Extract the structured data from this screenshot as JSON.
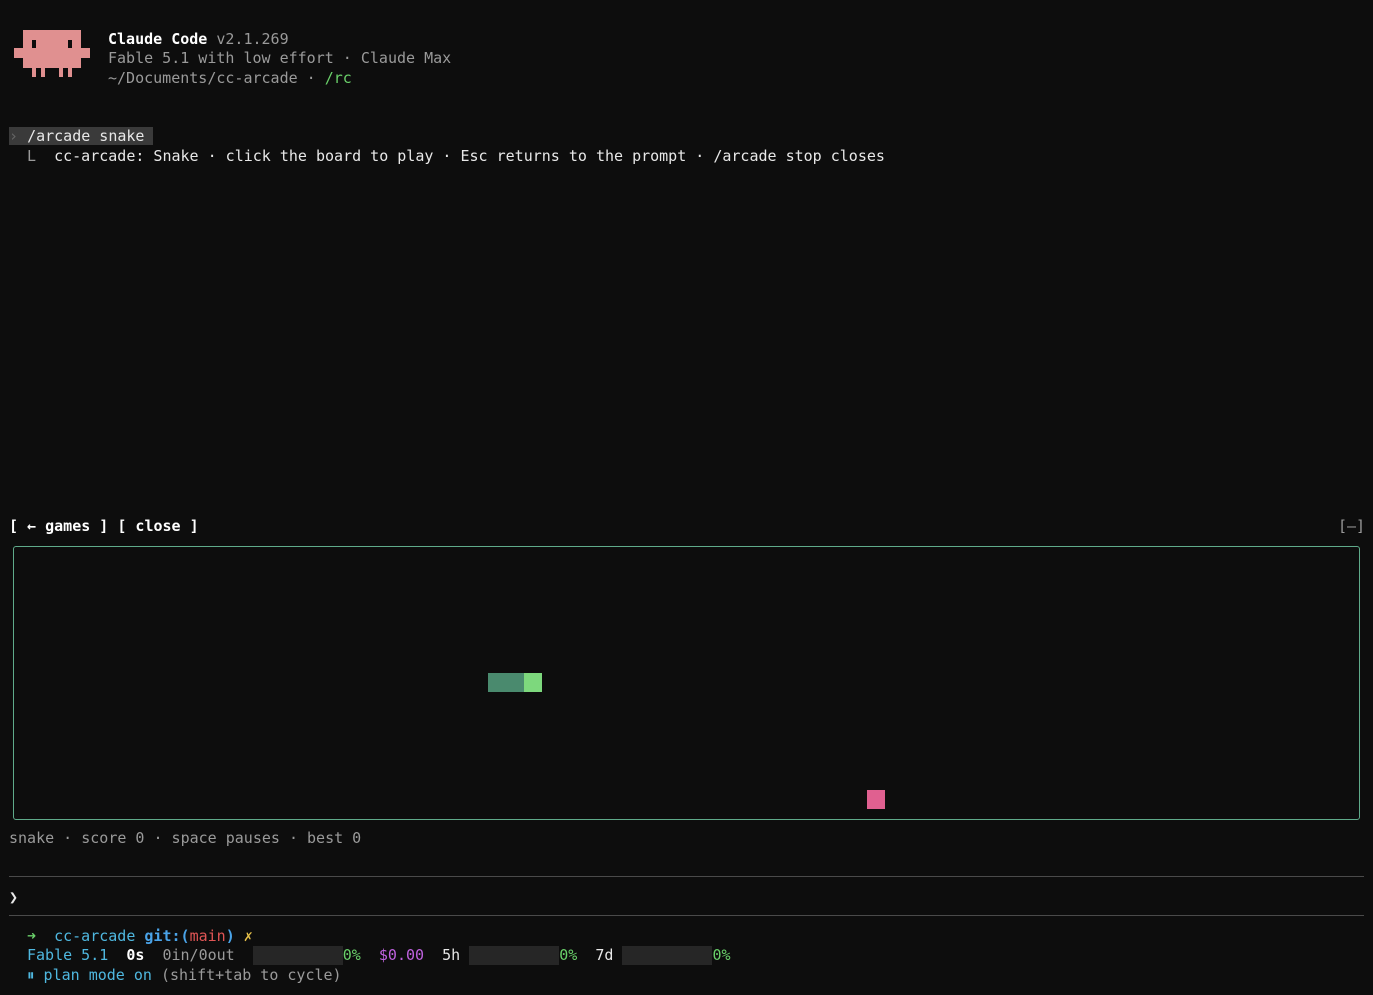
{
  "header": {
    "app_name": "Claude Code",
    "version": "v2.1.269",
    "model_line": "Fable 5.1 with low effort · Claude Max",
    "path": "~/Documents/cc-arcade",
    "separator": " · ",
    "rc": "/rc"
  },
  "transcript": {
    "prompt_marker": "›",
    "command": "/arcade snake",
    "reply_marker": "L",
    "reply": "cc-arcade: Snake · click the board to play · Esc returns to the prompt · /arcade stop closes"
  },
  "arcade_toolbar": {
    "games_button": "[ ← games ]",
    "close_button": "[ close ]",
    "minimize_button": "[–]"
  },
  "game": {
    "status_line": "snake · score 0 · space pauses · best 0",
    "colors": {
      "snake_body": "#4a8a6e",
      "snake_head": "#7dd87d",
      "food": "#e06090",
      "border": "#5faa8a"
    }
  },
  "input": {
    "prompt_glyph": "❯",
    "value": ""
  },
  "statusbar": {
    "arrow": "➜",
    "dir": "cc-arcade",
    "git_label": "git:(",
    "branch": "main",
    "git_close": ")",
    "dirty": "✗",
    "model": "Fable 5.1",
    "time": "0s",
    "tokens": "0in/0out",
    "context_pct": "0%",
    "context_level": 0,
    "cost": "$0.00",
    "window_5h": "5h",
    "pct_5h": "0%",
    "level_5h": 0,
    "window_7d": "7d",
    "pct_7d": "0%",
    "level_7d": 0,
    "mode_icon": "⏸",
    "mode_text": "plan mode on",
    "mode_hint": "(shift+tab to cycle)"
  }
}
